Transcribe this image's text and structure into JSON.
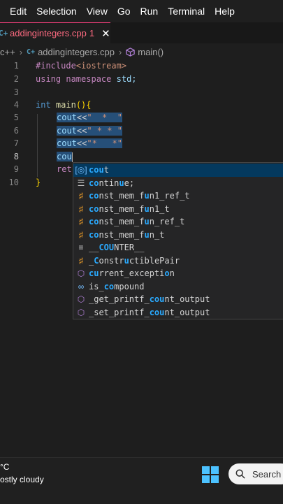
{
  "menubar": {
    "items": [
      "Edit",
      "Selection",
      "View",
      "Go",
      "Run",
      "Terminal",
      "Help"
    ]
  },
  "tab": {
    "icon": "cpp-file-icon",
    "icon_text": "C+",
    "label": "addingintegers.cpp",
    "problems": "1",
    "close": "✕"
  },
  "breadcrumb": {
    "lang": "c++",
    "file": "addingintegers.cpp",
    "symbol": "main()"
  },
  "editor": {
    "line_numbers": [
      "1",
      "2",
      "3",
      "4",
      "5",
      "6",
      "7",
      "8",
      "9",
      "10"
    ],
    "active_line": "8",
    "lines": {
      "l1_a": "#include",
      "l1_b": "<iostream>",
      "l2_a": "using",
      "l2_b": "namespace",
      "l2_c": "std;",
      "l4_a": "int",
      "l4_b": "main",
      "l4_c": "(){",
      "l5_a": "cout",
      "l5_b": "<<",
      "l5_c": "\"  *  \"",
      "l6_a": "cout",
      "l6_b": "<<",
      "l6_c": "\" * * \"",
      "l7_a": "cout",
      "l7_b": "<<",
      "l7_c": "\"*   *\"",
      "l8_a": "cou",
      "l9_a": "ret",
      "l10_a": "}"
    }
  },
  "suggest": {
    "items": [
      {
        "icon": "variable-icon",
        "glyph": "[◎]",
        "pre": "",
        "match": "cou",
        "post": "t"
      },
      {
        "icon": "snippet-icon",
        "glyph": "☰",
        "pre": "",
        "match": "co",
        "post": "ntin",
        "post2": "u",
        "post3": "e;"
      },
      {
        "icon": "class-icon",
        "glyph": "♯",
        "pre": "",
        "match": "co",
        "post": "nst_mem_f",
        "post2": "u",
        "post3": "n1_ref_t"
      },
      {
        "icon": "class-icon",
        "glyph": "♯",
        "pre": "",
        "match": "co",
        "post": "nst_mem_f",
        "post2": "u",
        "post3": "n1_t"
      },
      {
        "icon": "class-icon",
        "glyph": "♯",
        "pre": "",
        "match": "co",
        "post": "nst_mem_f",
        "post2": "u",
        "post3": "n_ref_t"
      },
      {
        "icon": "class-icon",
        "glyph": "♯",
        "pre": "",
        "match": "co",
        "post": "nst_mem_f",
        "post2": "u",
        "post3": "n_t"
      },
      {
        "icon": "constant-icon",
        "glyph": "≡",
        "pre": "__",
        "match": "COU",
        "post": "NTER__"
      },
      {
        "icon": "class-icon",
        "glyph": "♯",
        "pre": "_",
        "match": "C",
        "post": "onstr",
        "post2": "u",
        "post3": "ctiblePair"
      },
      {
        "icon": "struct-icon",
        "glyph": "⬡",
        "pre": "",
        "match": "cu",
        "post": "rrent_excepti",
        "post2": "o",
        "post3": "n"
      },
      {
        "icon": "field-icon",
        "glyph": "∞",
        "pre": "is_",
        "match": "co",
        "post": "mpound"
      },
      {
        "icon": "struct-icon",
        "glyph": "⬡",
        "pre": "_get_printf_",
        "match": "cou",
        "post": "nt_output"
      },
      {
        "icon": "struct-icon",
        "glyph": "⬡",
        "pre": "_set_printf_",
        "match": "cou",
        "post": "nt_output"
      }
    ]
  },
  "taskbar": {
    "temp": "°C",
    "weather": "ostly cloudy",
    "search_label": "Search"
  },
  "colors": {
    "accent_pink": "#ff6b81",
    "selection": "#264f78",
    "suggest_highlight": "#2aaaff",
    "windows_blue": "#4cc2ff"
  }
}
